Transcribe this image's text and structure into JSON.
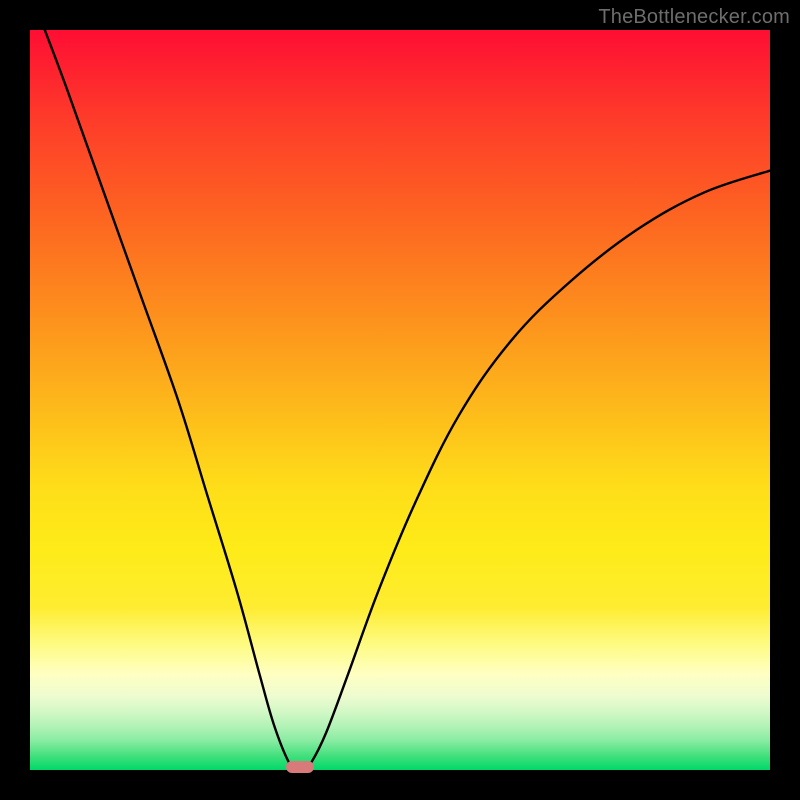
{
  "attribution": "TheBottlenecker.com",
  "colors": {
    "frame": "#000000",
    "curve": "#000000",
    "marker": "#d87a79",
    "gradient_stops": [
      {
        "pct": 0,
        "hex": "#fe0e33"
      },
      {
        "pct": 12,
        "hex": "#fe3b2a"
      },
      {
        "pct": 25,
        "hex": "#fd6421"
      },
      {
        "pct": 38,
        "hex": "#fd8e1d"
      },
      {
        "pct": 50,
        "hex": "#fdb61b"
      },
      {
        "pct": 62,
        "hex": "#fede19"
      },
      {
        "pct": 70,
        "hex": "#feeb18"
      },
      {
        "pct": 78,
        "hex": "#feec31"
      },
      {
        "pct": 83,
        "hex": "#fefb82"
      },
      {
        "pct": 87,
        "hex": "#ffffc1"
      },
      {
        "pct": 90,
        "hex": "#eefcd0"
      },
      {
        "pct": 92,
        "hex": "#d4f8c7"
      },
      {
        "pct": 94,
        "hex": "#b3f3b7"
      },
      {
        "pct": 96,
        "hex": "#8aeca2"
      },
      {
        "pct": 98,
        "hex": "#46e07e"
      },
      {
        "pct": 100,
        "hex": "#00d968"
      }
    ]
  },
  "chart_data": {
    "type": "line",
    "title": "",
    "xlabel": "",
    "ylabel": "",
    "xlim": [
      0,
      100
    ],
    "ylim": [
      0,
      100
    ],
    "grid": false,
    "x": [
      2,
      5,
      10,
      15,
      20,
      24,
      28,
      31,
      33,
      35,
      36,
      37,
      38,
      40,
      43,
      47,
      52,
      58,
      65,
      73,
      82,
      91,
      100
    ],
    "values": [
      100,
      92,
      78,
      64,
      50,
      37,
      24,
      13,
      6,
      1,
      0.2,
      0.1,
      1,
      5,
      13,
      24,
      36,
      48,
      58,
      66,
      73,
      78,
      81
    ],
    "minimum_marker": {
      "x": 36.5,
      "y": 0.4
    }
  }
}
